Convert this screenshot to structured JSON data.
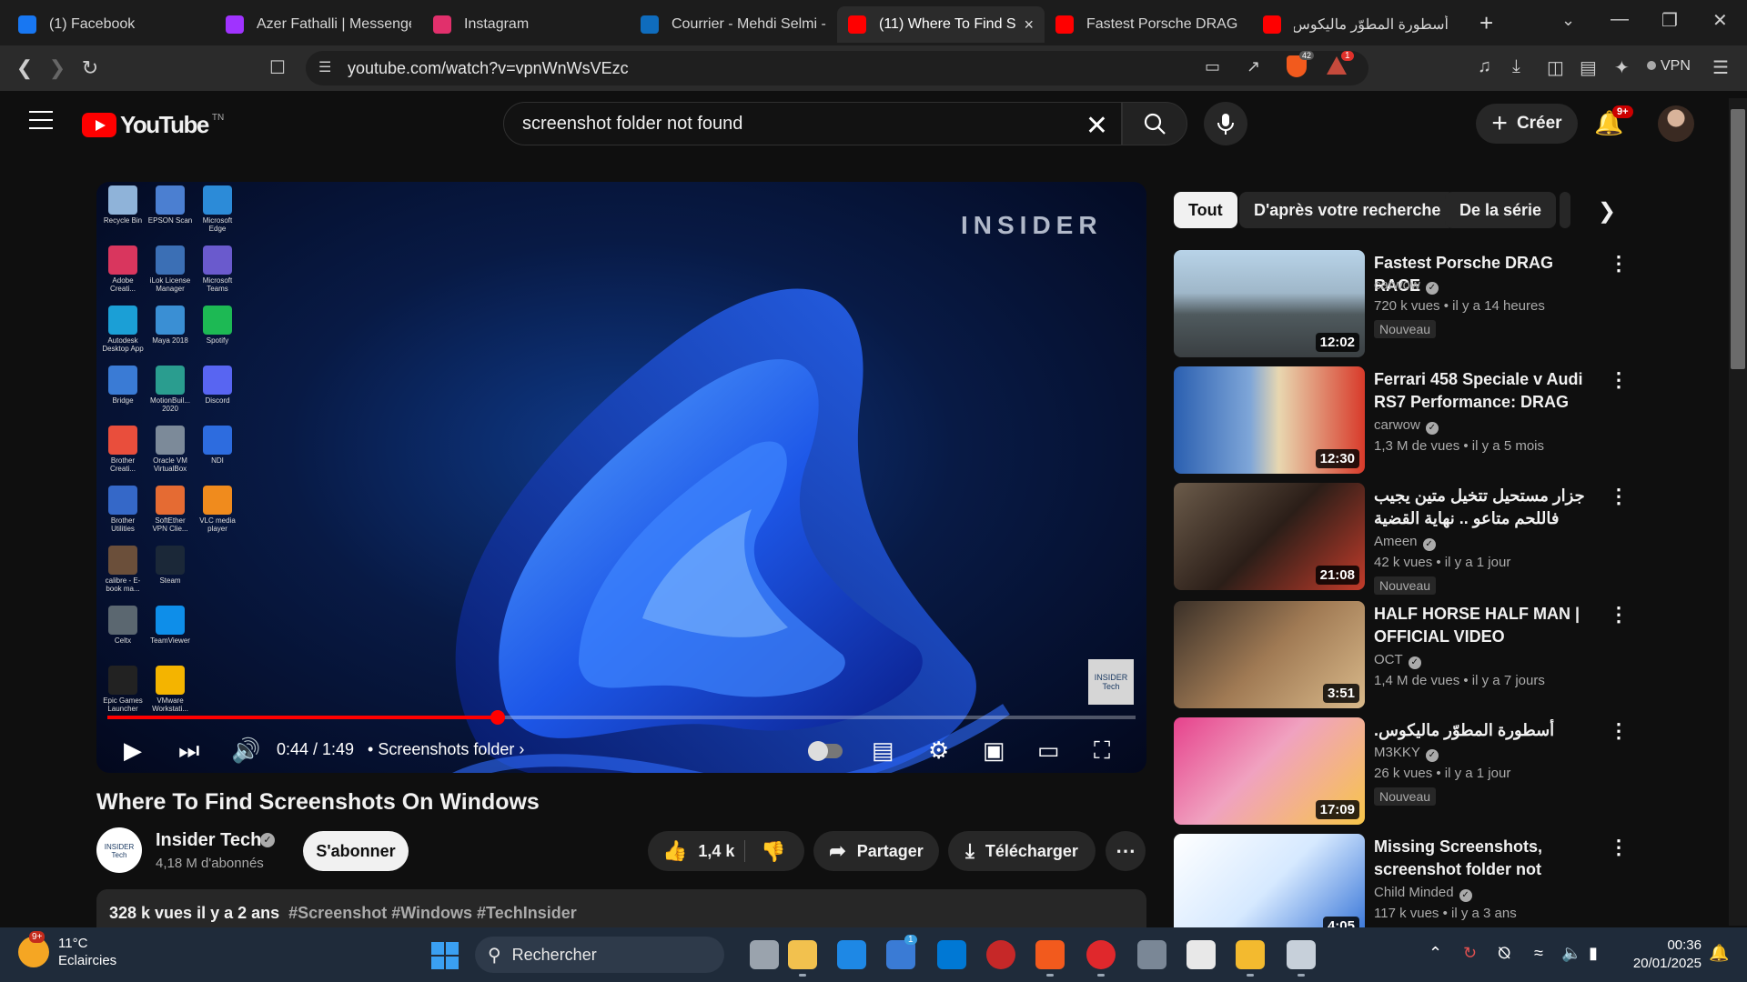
{
  "browser": {
    "tabs": [
      {
        "title": "(1) Facebook",
        "icon": "facebook-icon",
        "color": "#1877f2"
      },
      {
        "title": "Azer Fathalli | Messenger",
        "icon": "messenger-icon",
        "color": "#a033ff"
      },
      {
        "title": "Instagram",
        "icon": "instagram-icon",
        "color": "#e1306c"
      },
      {
        "title": "Courrier - Mehdi Selmi - (",
        "icon": "outlook-icon",
        "color": "#0f6cbd"
      },
      {
        "title": "(11) Where To Find S",
        "icon": "youtube-icon",
        "color": "#ff0000",
        "active": true
      },
      {
        "title": "Fastest Porsche DRAG RA",
        "icon": "youtube-icon",
        "color": "#ff0000"
      },
      {
        "title": "أسطورة المطوّر ماليكوس.",
        "icon": "youtube-icon",
        "color": "#ff0000"
      }
    ],
    "url": "youtube.com/watch?v=vpnWnWsVEzc",
    "vpn_label": "VPN",
    "brave_badge": "42",
    "rewards_badge": "1"
  },
  "header": {
    "logo_text": "YouTube",
    "logo_tm": "TN",
    "search_value": "screenshot folder not found",
    "create_label": "Créer",
    "notif_count": "9+"
  },
  "player": {
    "watermark": "INSIDER",
    "badge_text": "INSIDER Tech",
    "time": "0:44 / 1:49",
    "chapter": "Screenshots folder",
    "progress": 0.38,
    "desktop_icons": [
      "Recycle Bin",
      "EPSON Scan",
      "Microsoft Edge",
      "Adobe Creati...",
      "iLok License Manager",
      "Microsoft Teams",
      "Autodesk Desktop App",
      "Maya 2018",
      "Spotify",
      "Bridge",
      "MotionBuil... 2020",
      "Discord",
      "Brother Creati...",
      "Oracle VM VirtualBox",
      "NDI",
      "Brother Utilities",
      "SoftEther VPN Clie...",
      "VLC media player",
      "calibre - E-book ma...",
      "Steam",
      "",
      "Celtx",
      "TeamViewer",
      "",
      "Epic Games Launcher",
      "VMware Workstati...",
      ""
    ]
  },
  "video": {
    "title": "Where To Find Screenshots On Windows",
    "channel": "Insider Tech",
    "channel_avatar_text": "INSIDER Tech",
    "subscribers": "4,18 M d'abonnés",
    "subscribe_label": "S'abonner",
    "likes": "1,4 k",
    "share_label": "Partager",
    "download_label": "Télécharger",
    "views_line": "328 k vues  il y a 2 ans",
    "tags": "#Screenshot #Windows #TechInsider"
  },
  "chips": [
    "Tout",
    "D'après votre recherche",
    "De la série"
  ],
  "recommendations": [
    {
      "title": "Fastest Porsche DRAG RACE",
      "channel": "carwow",
      "meta": "720 k vues  • il y a 14 heures",
      "badge": "Nouveau",
      "duration": "12:02"
    },
    {
      "title": "Ferrari 458 Speciale v Audi RS7 Performance: DRAG RACE",
      "channel": "carwow",
      "meta": "1,3 M de vues  • il y a 5 mois",
      "badge": "",
      "duration": "12:30"
    },
    {
      "title": "جزار مستحيل تتخيل متين يجيب فاللحم متاعو .. نهاية القضية صادمة للكبار فقط",
      "channel": "Ameen",
      "meta": "42 k vues  • il y a 1 jour",
      "badge": "Nouveau",
      "duration": "21:08"
    },
    {
      "title": "HALF HORSE HALF MAN | OFFICIAL VIDEO",
      "channel": "OCT",
      "meta": "1,4 M de vues  • il y a 7 jours",
      "badge": "",
      "duration": "3:51"
    },
    {
      "title": "أسطورة المطوّر ماليكوس.",
      "channel": "M3KKY",
      "meta": "26 k vues  • il y a 1 jour",
      "badge": "Nouveau",
      "duration": "17:09"
    },
    {
      "title": "Missing Screenshots, screenshot folder not found,...",
      "channel": "Child Minded",
      "meta": "117 k vues  • il y a 3 ans",
      "badge": "",
      "duration": "4:05"
    }
  ],
  "taskbar": {
    "temp": "11°C",
    "weather": "Eclaircies",
    "weather_badge": "9+",
    "search_placeholder": "Rechercher",
    "store_badge": "1",
    "time": "00:36",
    "date": "20/01/2025"
  }
}
